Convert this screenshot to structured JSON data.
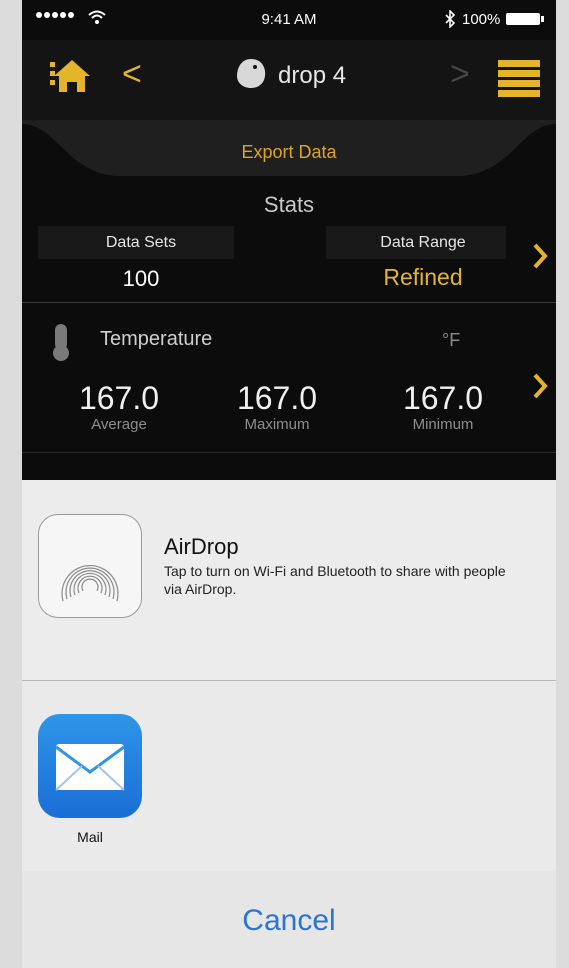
{
  "status_bar": {
    "time": "9:41 AM",
    "battery": "100%"
  },
  "nav": {
    "device_name": "drop 4",
    "prev": "<",
    "next": ">"
  },
  "export": {
    "label": "Export Data"
  },
  "stats": {
    "title": "Stats",
    "data_sets_label": "Data Sets",
    "data_sets_value": "100",
    "data_range_label": "Data Range",
    "data_range_value": "Refined"
  },
  "temperature": {
    "label": "Temperature",
    "unit": "°F",
    "readings": [
      {
        "value": "167.0",
        "label": "Average"
      },
      {
        "value": "167.0",
        "label": "Maximum"
      },
      {
        "value": "167.0",
        "label": "Minimum"
      }
    ]
  },
  "share": {
    "airdrop_title": "AirDrop",
    "airdrop_desc": "Tap to turn on Wi-Fi and Bluetooth to share with people via AirDrop.",
    "apps": [
      {
        "label": "Mail",
        "icon": "mail-icon"
      }
    ],
    "cancel_label": "Cancel"
  },
  "colors": {
    "accent": "#e4b52a",
    "link": "#2a74d6"
  }
}
